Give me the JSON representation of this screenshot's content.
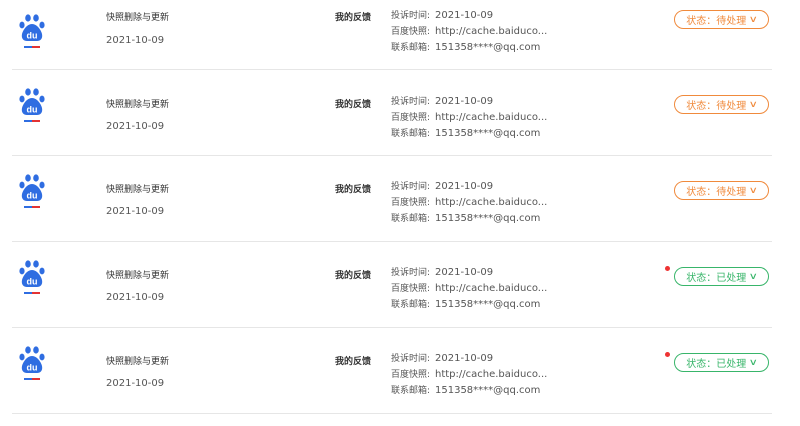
{
  "rows": [
    {
      "title": "快照删除与更新",
      "date": "2021-10-09",
      "feedback": "我的反馈",
      "complaint_label": "投诉时间:",
      "complaint_time": "2021-10-09",
      "snapshot_label": "百度快照:",
      "snapshot_url": "http://cache.baiduco...",
      "email_label": "联系邮箱:",
      "email": "151358****@qq.com",
      "status": "状态：待处理",
      "status_type": "pending",
      "unread": false
    },
    {
      "title": "快照删除与更新",
      "date": "2021-10-09",
      "feedback": "我的反馈",
      "complaint_label": "投诉时间:",
      "complaint_time": "2021-10-09",
      "snapshot_label": "百度快照:",
      "snapshot_url": "http://cache.baiduco...",
      "email_label": "联系邮箱:",
      "email": "151358****@qq.com",
      "status": "状态：待处理",
      "status_type": "pending",
      "unread": false
    },
    {
      "title": "快照删除与更新",
      "date": "2021-10-09",
      "feedback": "我的反馈",
      "complaint_label": "投诉时间:",
      "complaint_time": "2021-10-09",
      "snapshot_label": "百度快照:",
      "snapshot_url": "http://cache.baiduco...",
      "email_label": "联系邮箱:",
      "email": "151358****@qq.com",
      "status": "状态：待处理",
      "status_type": "pending",
      "unread": false
    },
    {
      "title": "快照删除与更新",
      "date": "2021-10-09",
      "feedback": "我的反馈",
      "complaint_label": "投诉时间:",
      "complaint_time": "2021-10-09",
      "snapshot_label": "百度快照:",
      "snapshot_url": "http://cache.baiduco...",
      "email_label": "联系邮箱:",
      "email": "151358****@qq.com",
      "status": "状态：已处理",
      "status_type": "done",
      "unread": true
    },
    {
      "title": "快照删除与更新",
      "date": "2021-10-09",
      "feedback": "我的反馈",
      "complaint_label": "投诉时间:",
      "complaint_time": "2021-10-09",
      "snapshot_label": "百度快照:",
      "snapshot_url": "http://cache.baiduco...",
      "email_label": "联系邮箱:",
      "email": "151358****@qq.com",
      "status": "状态：已处理",
      "status_type": "done",
      "unread": true
    }
  ],
  "colors": {
    "pending": "#f08a3c",
    "done": "#38b56a",
    "unread_dot": "#e33333",
    "logo_blue": "#2f6de1",
    "logo_red": "#e33333"
  },
  "icons": {
    "logo": "baidu-paw-logo-icon",
    "status_toggle": "chevron-down-icon",
    "unread": "unread-dot"
  }
}
